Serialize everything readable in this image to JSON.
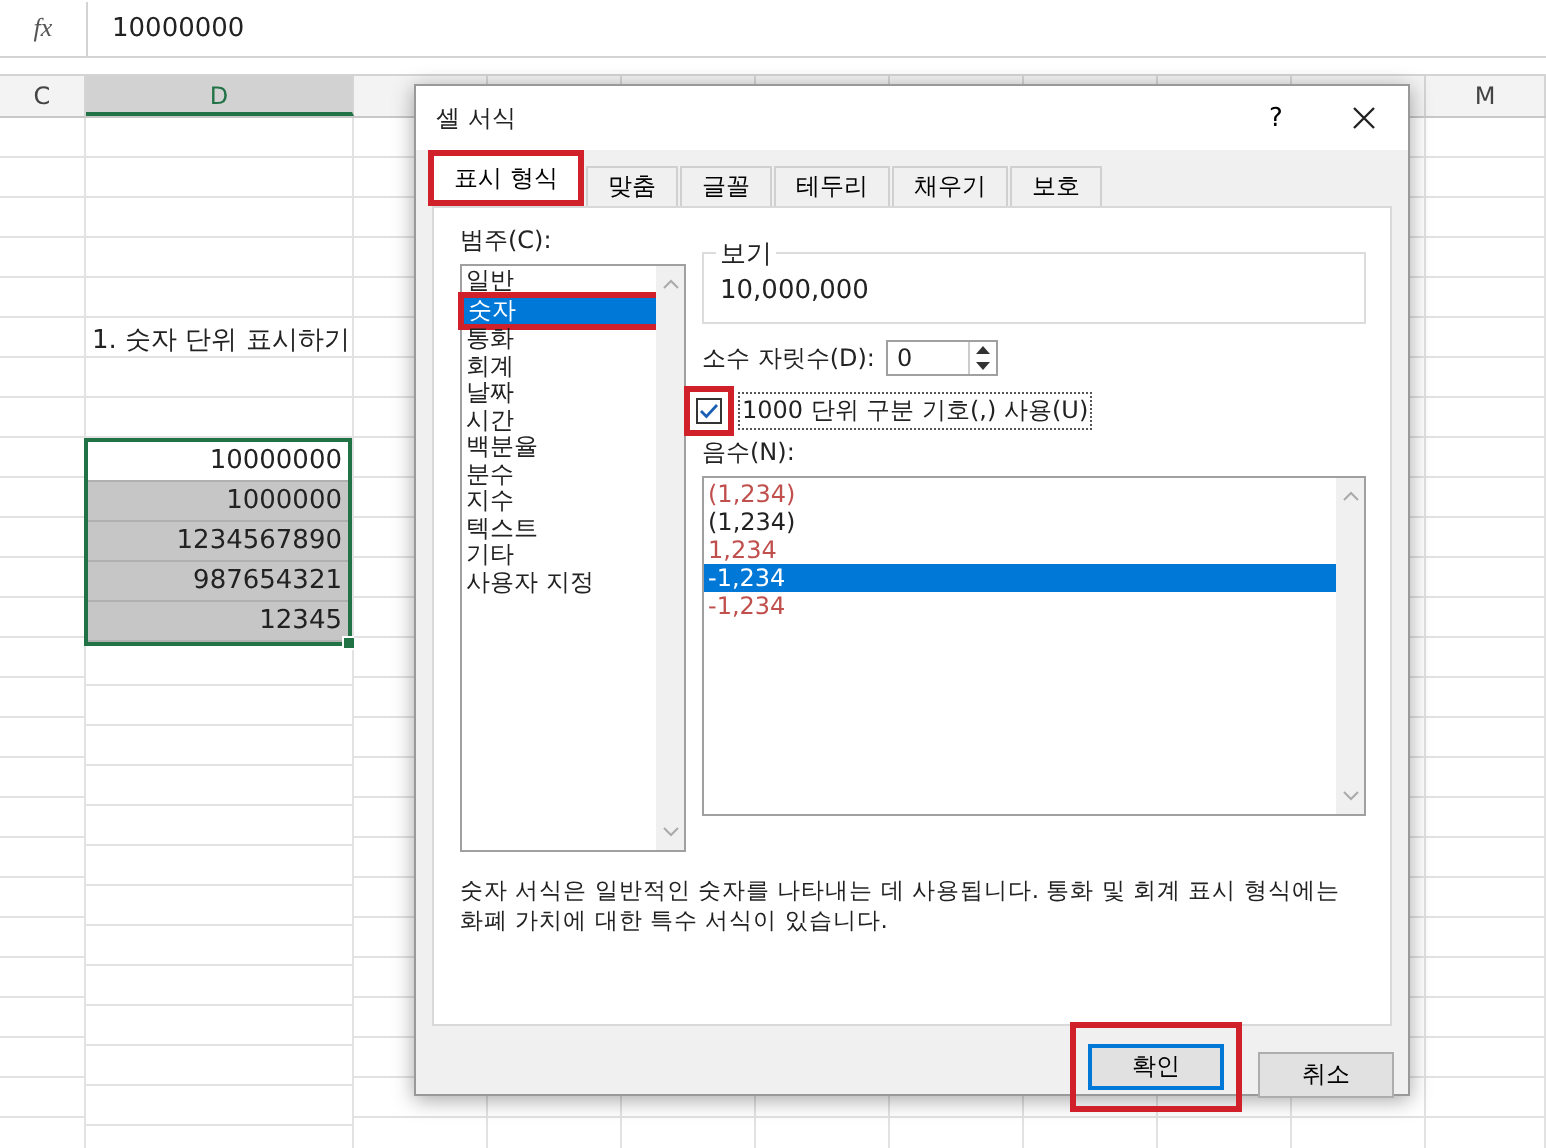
{
  "formula_bar": {
    "fx": "fx",
    "value": "10000000"
  },
  "column_headers": [
    {
      "label": "C",
      "selected": false
    },
    {
      "label": "D",
      "selected": true
    },
    {
      "label": "M",
      "selected": false
    }
  ],
  "sheet": {
    "title": "1. 숫자 단위 표시하기",
    "values": [
      {
        "value": "10000000",
        "active": true
      },
      {
        "value": "1000000",
        "active": false
      },
      {
        "value": "1234567890",
        "active": false
      },
      {
        "value": "987654321",
        "active": false
      },
      {
        "value": "12345",
        "active": false
      }
    ]
  },
  "dialog": {
    "title": "셀 서식",
    "help": "?",
    "tabs": [
      {
        "label": "표시 형식",
        "selected": true,
        "highlighted": true
      },
      {
        "label": "맞춤",
        "selected": false,
        "highlighted": false
      },
      {
        "label": "글꼴",
        "selected": false,
        "highlighted": false
      },
      {
        "label": "테두리",
        "selected": false,
        "highlighted": false
      },
      {
        "label": "채우기",
        "selected": false,
        "highlighted": false
      },
      {
        "label": "보호",
        "selected": false,
        "highlighted": false
      }
    ],
    "category_label": "범주(C):",
    "categories": [
      {
        "label": "일반",
        "selected": false,
        "highlighted": false
      },
      {
        "label": "숫자",
        "selected": true,
        "highlighted": true
      },
      {
        "label": "통화",
        "selected": false,
        "highlighted": false
      },
      {
        "label": "회계",
        "selected": false,
        "highlighted": false
      },
      {
        "label": "날짜",
        "selected": false,
        "highlighted": false
      },
      {
        "label": "시간",
        "selected": false,
        "highlighted": false
      },
      {
        "label": "백분율",
        "selected": false,
        "highlighted": false
      },
      {
        "label": "분수",
        "selected": false,
        "highlighted": false
      },
      {
        "label": "지수",
        "selected": false,
        "highlighted": false
      },
      {
        "label": "텍스트",
        "selected": false,
        "highlighted": false
      },
      {
        "label": "기타",
        "selected": false,
        "highlighted": false
      },
      {
        "label": "사용자 지정",
        "selected": false,
        "highlighted": false
      }
    ],
    "sample": {
      "label": "보기",
      "value": "10,000,000"
    },
    "decimals": {
      "label": "소수 자릿수(D):",
      "value": "0"
    },
    "separator": {
      "label": "1000 단위 구분 기호(,) 사용(U)",
      "checked": true,
      "highlighted": true
    },
    "negative_label": "음수(N):",
    "negatives": [
      {
        "label": "(1,234)",
        "color": "#c0504d",
        "selected": false
      },
      {
        "label": "(1,234)",
        "color": "#222222",
        "selected": false
      },
      {
        "label": "1,234",
        "color": "#c0504d",
        "selected": false
      },
      {
        "label": "-1,234",
        "selected": true
      },
      {
        "label": "-1,234",
        "color": "#c0504d",
        "selected": false
      }
    ],
    "description": "숫자 서식은 일반적인 숫자를 나타내는 데 사용됩니다. 통화 및 회계 표시 형식에는 화폐 가치에 대한 특수 서식이 있습니다.",
    "buttons": [
      {
        "label": "확인",
        "kind": "default",
        "highlighted": true
      },
      {
        "label": "취소",
        "kind": "normal",
        "highlighted": false
      }
    ]
  }
}
